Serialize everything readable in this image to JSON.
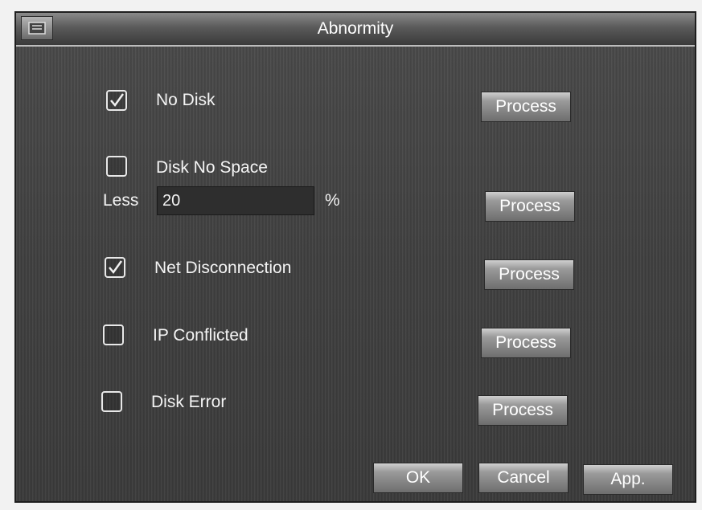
{
  "window": {
    "title": "Abnormity"
  },
  "items": {
    "no_disk": {
      "label": "No Disk",
      "checked": true,
      "process_label": "Process"
    },
    "disk_no_space": {
      "label": "Disk No Space",
      "checked": false,
      "less_label": "Less",
      "less_value": "20",
      "unit": "%",
      "process_label": "Process"
    },
    "net_disconnection": {
      "label": "Net Disconnection",
      "checked": true,
      "process_label": "Process"
    },
    "ip_conflicted": {
      "label": "IP Conflicted",
      "checked": false,
      "process_label": "Process"
    },
    "disk_error": {
      "label": "Disk Error",
      "checked": false,
      "process_label": "Process"
    }
  },
  "footer": {
    "ok_label": "OK",
    "cancel_label": "Cancel",
    "apply_label": "App."
  },
  "icons": {
    "title": "settings-window-icon",
    "check": "checkmark-icon"
  }
}
